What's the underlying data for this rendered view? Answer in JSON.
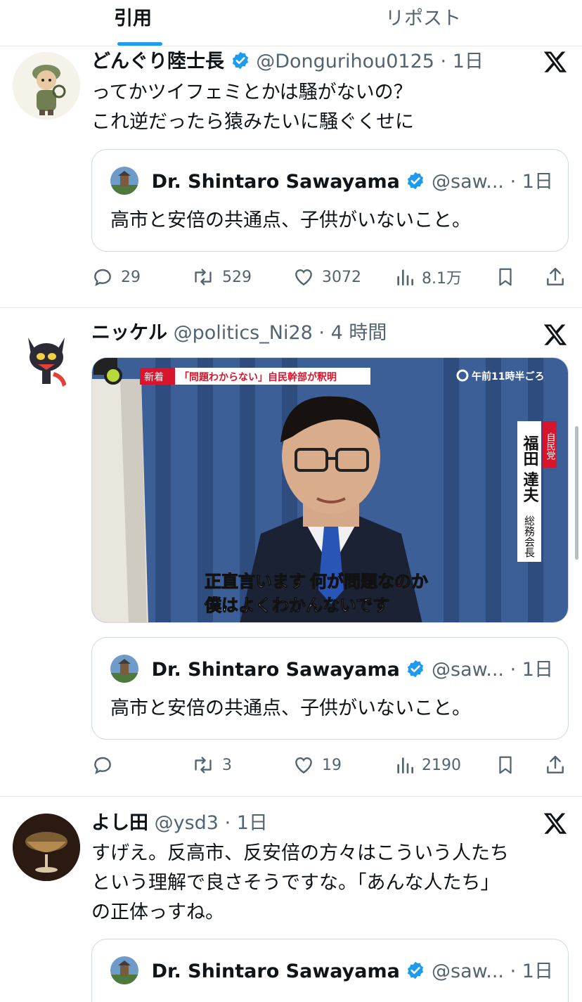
{
  "tabs": {
    "quote": "引用",
    "repost": "リポスト"
  },
  "colors": {
    "accent": "#1d9bf0",
    "text": "#0f1419",
    "muted": "#536471",
    "border": "#cfd9de",
    "news_red": "#d7162d"
  },
  "quoted_tweet": {
    "name": "Dr. Shintaro Sawayama",
    "handle": "@saw...",
    "time": "1日",
    "text": "高市と安倍の共通点、子供がいないこと。"
  },
  "tweets": [
    {
      "name": "どんぐり陸士長",
      "handle": "@Donguri­hou0125",
      "time": "1日",
      "verified": true,
      "lines": [
        "ってかツイフェミとかは騒がないの？",
        "これ逆だったら猿みたいに騒ぐくせに"
      ],
      "stats": {
        "replies": "29",
        "reposts": "529",
        "likes": "3072",
        "views": "8.1万"
      }
    },
    {
      "name": "ニッケル",
      "handle": "@politics_Ni28",
      "time": "4 時間",
      "verified": false,
      "media": {
        "badge": "新着",
        "headline": "「問題わからない」自民幹部が釈明",
        "time_label": "午前11時半ごろ",
        "party": "自民党",
        "person": "福田 達夫",
        "role": "総務会長",
        "subtitle_line1_white": "正直言います",
        "subtitle_line1_red": "何が問題なのか",
        "subtitle_line2": "僕はよくわかんないです",
        "logo": "NNN"
      },
      "stats": {
        "replies": "",
        "reposts": "3",
        "likes": "19",
        "views": "2190"
      }
    },
    {
      "name": "よし田",
      "handle": "@ysd3",
      "time": "1日",
      "verified": false,
      "lines": [
        "すげえ。反高市、反安倍の方々はこういう人たち",
        "という理解で良さそうですな。「あんな人たち」",
        "の正体っすね。"
      ]
    }
  ],
  "sep": "·"
}
